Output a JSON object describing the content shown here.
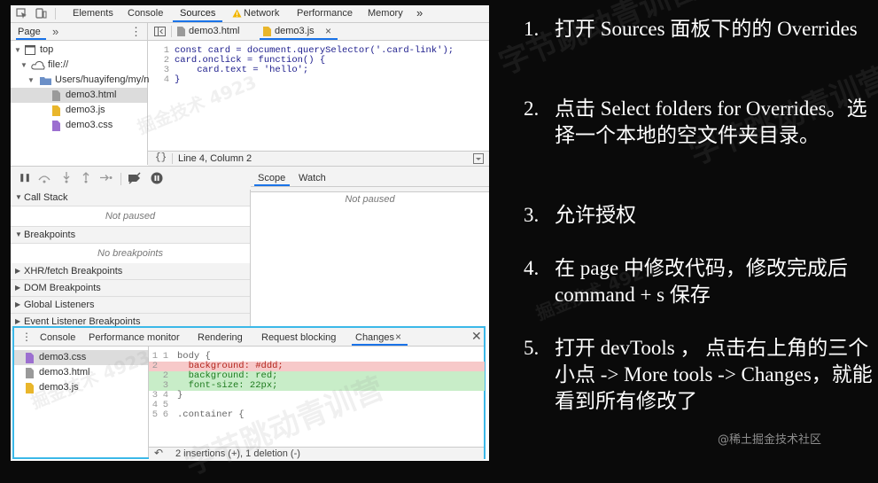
{
  "devtools": {
    "main_tabs": [
      "Elements",
      "Console",
      "Sources",
      "Network",
      "Performance",
      "Memory"
    ],
    "more_tabs": "»",
    "navigator": {
      "tab": "Page",
      "more": "»",
      "tree": [
        "top",
        "file://",
        "Users/huayifeng/my/n",
        "demo3.html",
        "demo3.js",
        "demo3.css"
      ]
    },
    "editor": {
      "tabs": [
        "demo3.html",
        "demo3.js"
      ],
      "close": "×",
      "line_numbers": [
        "1",
        "2",
        "3",
        "4"
      ],
      "lines": [
        "const card = document.querySelector('.card-link');",
        "card.onclick = function() {",
        "    card.text = 'hello';",
        "}"
      ],
      "status_braces": "{}",
      "status": "Line 4, Column 2"
    },
    "debugger": {
      "sections": [
        "Call Stack",
        "Breakpoints",
        "XHR/fetch Breakpoints",
        "DOM Breakpoints",
        "Global Listeners",
        "Event Listener Breakpoints"
      ],
      "not_paused": "Not paused",
      "no_breakpoints": "No breakpoints",
      "scope_tabs": [
        "Scope",
        "Watch"
      ],
      "scope_message": "Not paused"
    },
    "drawer": {
      "tabs": [
        "Console",
        "Performance monitor",
        "Rendering",
        "Request blocking",
        "Changes"
      ],
      "files": [
        "demo3.css",
        "demo3.html",
        "demo3.js"
      ],
      "diff": [
        {
          "old": "1",
          "new": "1",
          "text": "body {",
          "kind": "same"
        },
        {
          "old": "2",
          "new": "",
          "text": "  background: #ddd;",
          "kind": "del"
        },
        {
          "old": "",
          "new": "2",
          "text": "  background: red;",
          "kind": "add"
        },
        {
          "old": "",
          "new": "3",
          "text": "  font-size: 22px;",
          "kind": "add"
        },
        {
          "old": "3",
          "new": "4",
          "text": "}",
          "kind": "same"
        },
        {
          "old": "4",
          "new": "5",
          "text": "",
          "kind": "same"
        },
        {
          "old": "5",
          "new": "6",
          "text": ".container {",
          "kind": "same"
        }
      ],
      "summary": "2 insertions (+), 1 deletion (-)"
    }
  },
  "notes": [
    {
      "num": "1.",
      "text": "打开 Sources 面板下的的 Overrides"
    },
    {
      "num": "2.",
      "text": "点击 Select folders for Overrides。选择一个本地的空文件夹目录。"
    },
    {
      "num": "3.",
      "text": "允许授权"
    },
    {
      "num": "4.",
      "text": "在 page 中修改代码，修改完成后 command + s 保存"
    },
    {
      "num": "5.",
      "text": "打开 devTools ， 点击右上角的三个小点 -> More tools -> Changes，就能看到所有修改了"
    }
  ],
  "credit": "@稀土掘金技术社区",
  "watermarks": [
    "字节跳动青训营",
    "掘金技术 4923"
  ],
  "colors": {
    "accent": "#1a73e8",
    "drawer_border": "#3bb8e8",
    "diff_del": "#f7c9c9",
    "diff_add": "#c8edc8"
  }
}
